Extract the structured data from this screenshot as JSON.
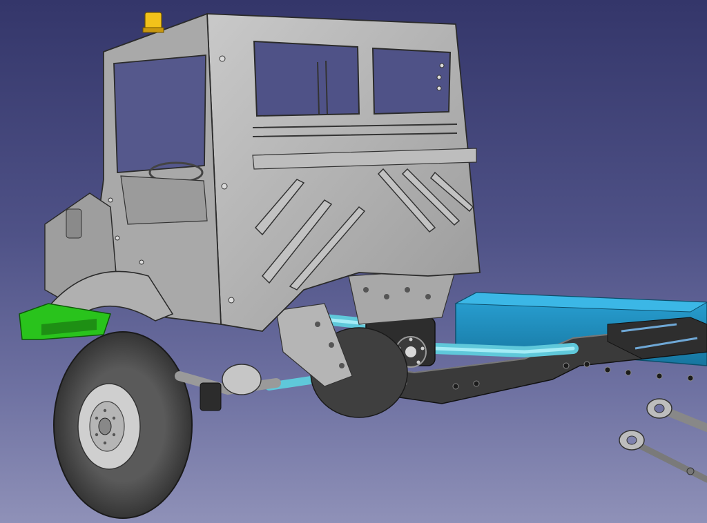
{
  "viewport": {
    "name": "3d-cad-viewport",
    "background_top": "#34366a",
    "background_bottom": "#8f91b8"
  },
  "model": {
    "description_icon": "truck-chassis-model",
    "colors": {
      "cab": "#b4b4b4",
      "cab_dark": "#8c8c8c",
      "tire": "#3d3d3d",
      "rim": "#c8c8c8",
      "frame": "#3a3a3a",
      "shaft": "#74d6e6",
      "tank": "#1f8fc0",
      "bracket_green": "#29c31c",
      "beacon": "#f2c21a"
    }
  }
}
